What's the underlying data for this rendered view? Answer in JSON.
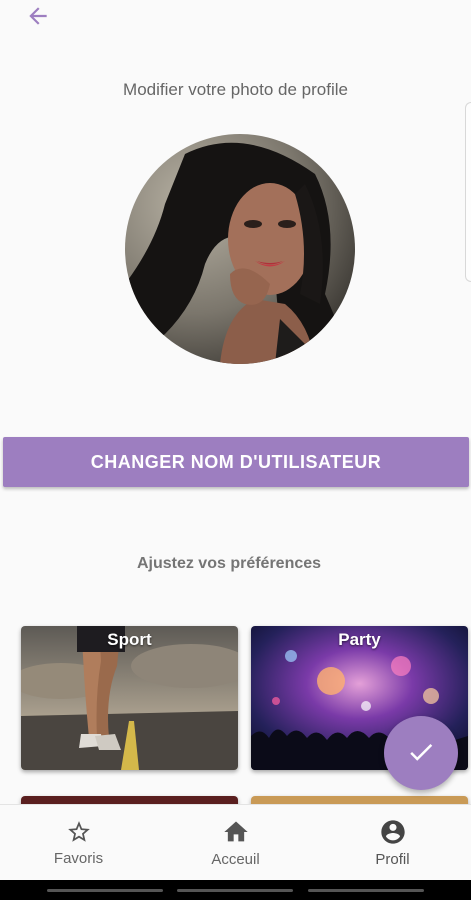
{
  "header": {
    "back_icon": "arrow-back-icon",
    "title": "Modifier votre photo de profile"
  },
  "profile": {
    "photo": "profile-photo"
  },
  "actions": {
    "change_username_label": "CHANGER NOM D'UTILISATEUR"
  },
  "preferences": {
    "title": "Ajustez vos préférences",
    "cards": [
      {
        "label": "Sport"
      },
      {
        "label": "Party"
      }
    ]
  },
  "fab": {
    "icon": "check-icon"
  },
  "bottom_nav": {
    "items": [
      {
        "label": "Favoris",
        "icon": "star-outline-icon"
      },
      {
        "label": "Acceuil",
        "icon": "home-icon"
      },
      {
        "label": "Profil",
        "icon": "account-circle-icon"
      }
    ]
  },
  "colors": {
    "accent": "#9d7ec0",
    "background": "#fafafa",
    "text": "#616161"
  }
}
